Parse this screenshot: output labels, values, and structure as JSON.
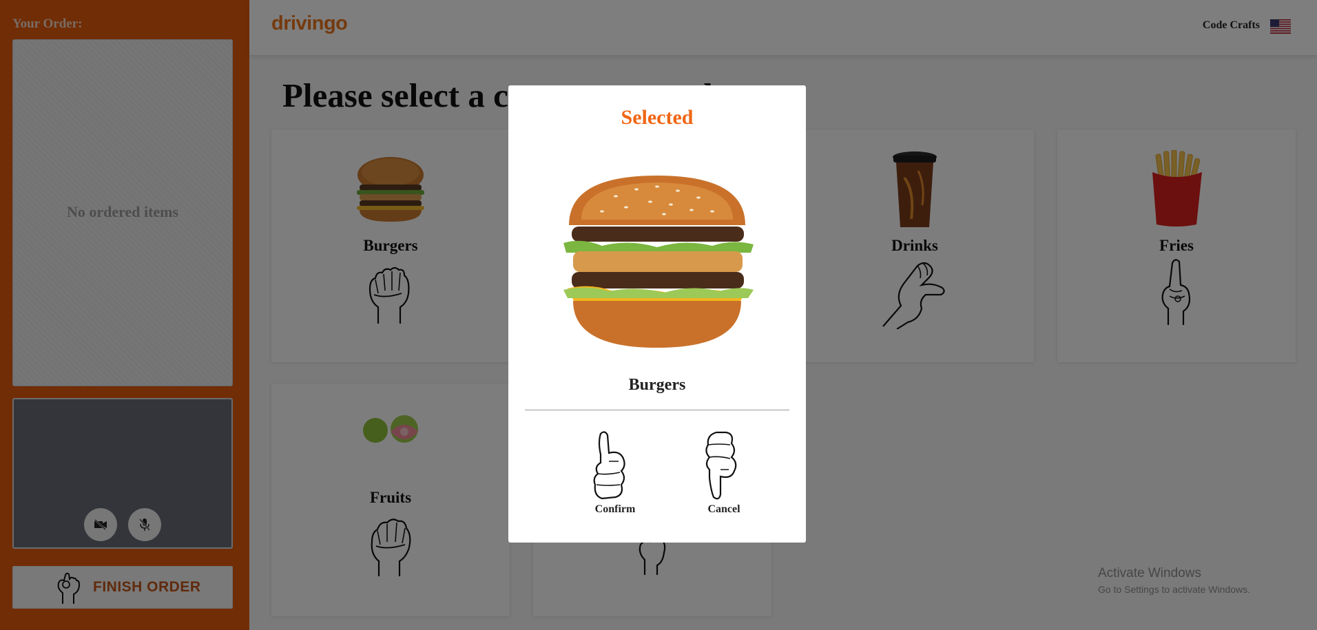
{
  "sidebar": {
    "order_title": "Your Order:",
    "empty_text": "No ordered items",
    "camera_icon": "camera-off-icon",
    "mic_icon": "mic-off-icon",
    "finish_label": "FINISH ORDER",
    "finish_icon": "ok-hand-sign-icon"
  },
  "header": {
    "logo": "drivingo",
    "brand": "Code Crafts",
    "language_icon": "us-flag-icon"
  },
  "main": {
    "title": "Please select a category to order",
    "categories": [
      {
        "label": "Burgers",
        "sign_icon": "fist-sign-icon"
      },
      {
        "label": "Drinks",
        "sign_icon": "c-hand-sign-icon"
      },
      {
        "label": "Fries",
        "sign_icon": "index-finger-sign-icon"
      },
      {
        "label": "Fruits",
        "sign_icon": "fist-sign-icon"
      }
    ]
  },
  "modal": {
    "title": "Selected",
    "item_name": "Burgers",
    "confirm_label": "Confirm",
    "cancel_label": "Cancel"
  },
  "watermark": {
    "line1": "Activate Windows",
    "line2": "Go to Settings to activate Windows."
  },
  "colors": {
    "accent": "#e35a0c",
    "modal_title": "#f06614"
  }
}
